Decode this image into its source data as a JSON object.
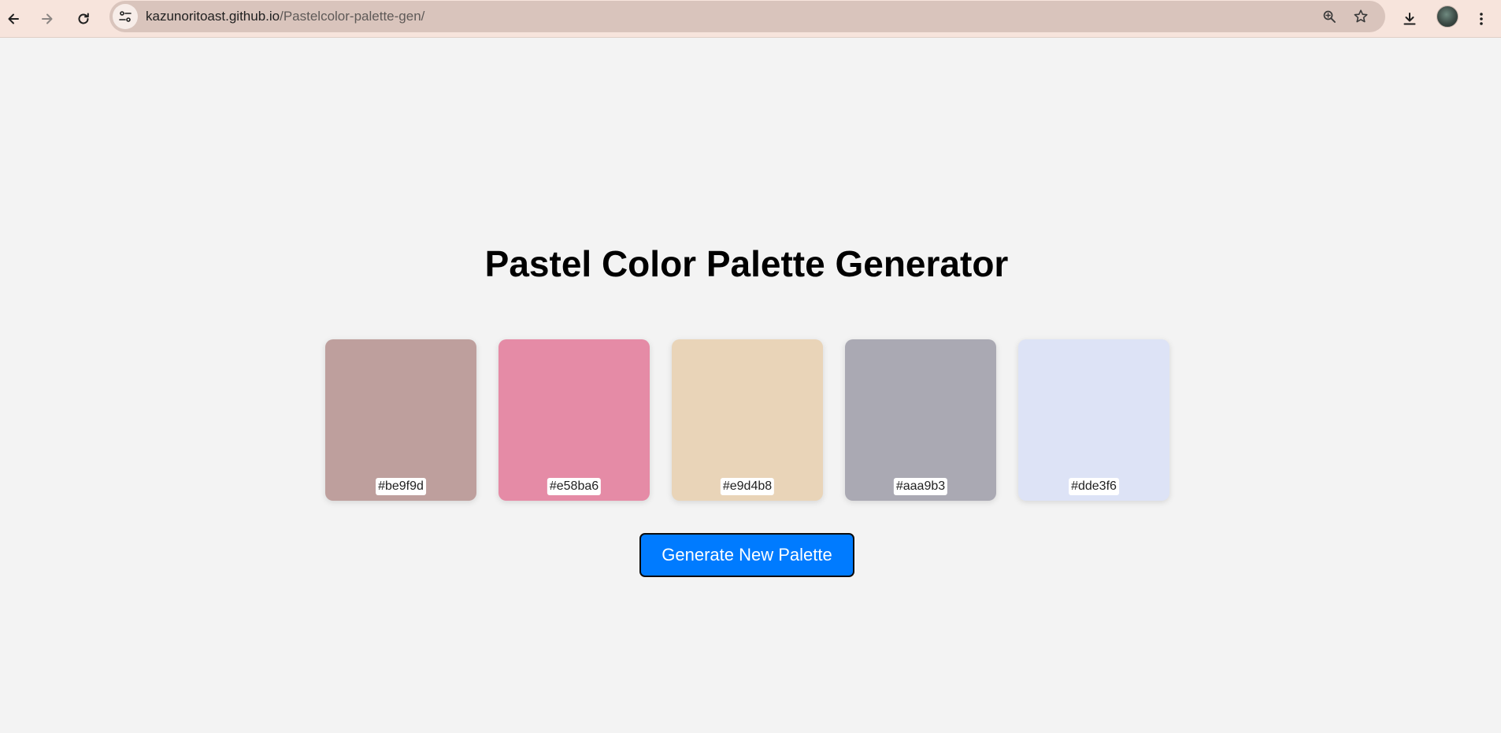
{
  "browser": {
    "url_host": "kazunoritoast.github.io",
    "url_path": "/Pastelcolor-palette-gen/",
    "icons": [
      "back-icon",
      "forward-icon",
      "reload-icon",
      "site-info-icon",
      "zoom-icon",
      "star-icon",
      "download-icon",
      "avatar",
      "menu-icon"
    ]
  },
  "page": {
    "title": "Pastel Color Palette Generator",
    "generate_button_label": "Generate New Palette",
    "button_color": "#007bff",
    "background_color": "#f3f3f3"
  },
  "palette": [
    {
      "hex": "#be9f9d"
    },
    {
      "hex": "#e58ba6"
    },
    {
      "hex": "#e9d4b8"
    },
    {
      "hex": "#aaa9b3"
    },
    {
      "hex": "#dde3f6"
    }
  ]
}
